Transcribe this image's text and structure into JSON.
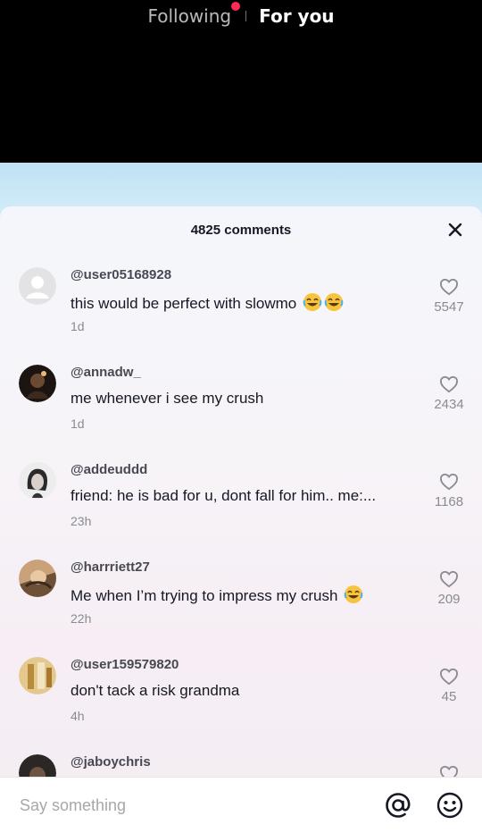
{
  "top_nav": {
    "following_label": "Following",
    "for_you_label": "For you",
    "notification_dot_color": "#fe2c55"
  },
  "comments_sheet": {
    "title": "4825 comments",
    "comments": [
      {
        "username": "@user05168928",
        "text": "this would be perfect with slowmo",
        "emoji": [
          "tears-of-joy",
          "tears-of-joy"
        ],
        "time": "1d",
        "likes": "5547"
      },
      {
        "username": "@annadw_",
        "text": "me whenever i see my crush",
        "emoji": [],
        "time": "1d",
        "likes": "2434"
      },
      {
        "username": "@addeuddd",
        "text": "friend: he is bad for u, dont fall for him.. me:...",
        "emoji": [],
        "time": "23h",
        "likes": "1168"
      },
      {
        "username": "@harrriett27",
        "text": "Me when I’m trying to impress my crush",
        "emoji": [
          "tears-of-joy"
        ],
        "time": "22h",
        "likes": "209"
      },
      {
        "username": "@user159579820",
        "text": "don't tack a risk grandma",
        "emoji": [],
        "time": "4h",
        "likes": "45"
      },
      {
        "username": "@jaboychris",
        "text": "",
        "emoji": [],
        "time": "",
        "likes": ""
      }
    ]
  },
  "input_bar": {
    "placeholder": "Say something",
    "mention_icon": "at-icon",
    "emoji_icon": "smiley-icon"
  }
}
